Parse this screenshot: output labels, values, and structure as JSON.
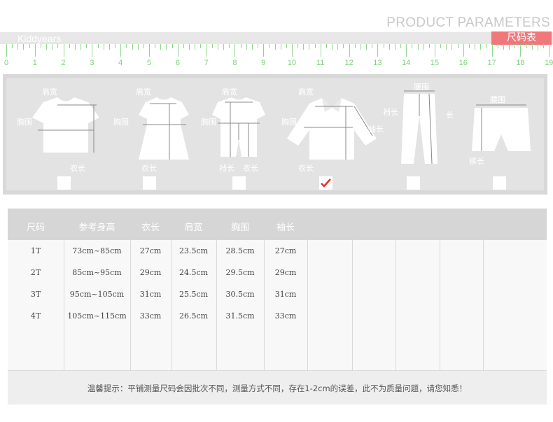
{
  "header": {
    "title": "PRODUCT PARAMETERS",
    "brand": "Kiddyears",
    "size_tag": "尺码表"
  },
  "ruler": {
    "labels": [
      "0",
      "1",
      "2",
      "3",
      "4",
      "5",
      "6",
      "7",
      "8",
      "9",
      "10",
      "11",
      "12",
      "13",
      "14",
      "15",
      "16",
      "17",
      "18",
      "19"
    ]
  },
  "garments": [
    {
      "name": "tshirt",
      "labels": [
        "肩宽",
        "胸围",
        "衣长"
      ],
      "checked": false
    },
    {
      "name": "dress",
      "labels": [
        "肩宽",
        "胸围",
        "衣长"
      ],
      "checked": false
    },
    {
      "name": "romper",
      "labels": [
        "肩宽",
        "胸围",
        "裆长",
        "衣长"
      ],
      "checked": false
    },
    {
      "name": "shirt",
      "labels": [
        "肩宽",
        "胸围",
        "袖长",
        "衣长"
      ],
      "checked": true
    },
    {
      "name": "pants",
      "labels": [
        "腰围",
        "裆长",
        "长"
      ],
      "checked": false
    },
    {
      "name": "shorts",
      "labels": [
        "腰围",
        "裤长"
      ],
      "checked": false
    }
  ],
  "table": {
    "headers": [
      "尺码",
      "参考身高",
      "衣长",
      "肩宽",
      "胸围",
      "袖长"
    ],
    "rows": [
      [
        "1T",
        "73cm~85cm",
        "27cm",
        "23.5cm",
        "28.5cm",
        "27cm"
      ],
      [
        "2T",
        "85cm~95cm",
        "29cm",
        "24.5cm",
        "29.5cm",
        "29cm"
      ],
      [
        "3T",
        "95cm~105cm",
        "31cm",
        "25.5cm",
        "30.5cm",
        "31cm"
      ],
      [
        "4T",
        "105cm~115cm",
        "33cm",
        "26.5cm",
        "31.5cm",
        "33cm"
      ]
    ],
    "note": "温馨提示：平铺测量尺码会因批次不同，测量方式不同，存在1-2cm的误差，此不为质量问题，请您知悉！"
  },
  "colors": {
    "accent": "#f0787a",
    "ruler": "#8fd98b",
    "check": "#e03030"
  }
}
